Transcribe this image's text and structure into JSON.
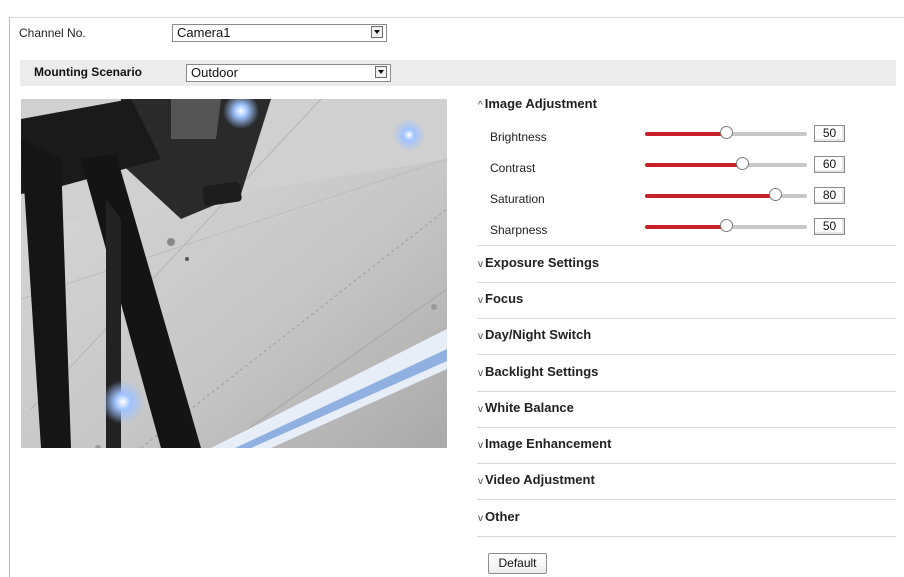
{
  "channel": {
    "label": "Channel No.",
    "selected": "Camera1"
  },
  "mounting": {
    "label": "Mounting Scenario",
    "selected": "Outdoor"
  },
  "sections": {
    "image_adjustment": "Image Adjustment",
    "exposure": "Exposure Settings",
    "focus": "Focus",
    "day_night": "Day/Night Switch",
    "backlight": "Backlight Settings",
    "white_balance": "White Balance",
    "enhancement": "Image Enhancement",
    "video_adjustment": "Video Adjustment",
    "other": "Other"
  },
  "params": {
    "brightness": {
      "label": "Brightness",
      "value": "50",
      "level": 0.5
    },
    "contrast": {
      "label": "Contrast",
      "value": "60",
      "level": 0.6
    },
    "saturation": {
      "label": "Saturation",
      "value": "80",
      "level": 0.8
    },
    "sharpness": {
      "label": "Sharpness",
      "value": "50",
      "level": 0.5
    }
  },
  "buttons": {
    "default": "Default"
  },
  "colors": {
    "slider_fill": "#c8202a",
    "slider_track": "#c8c8c8"
  }
}
